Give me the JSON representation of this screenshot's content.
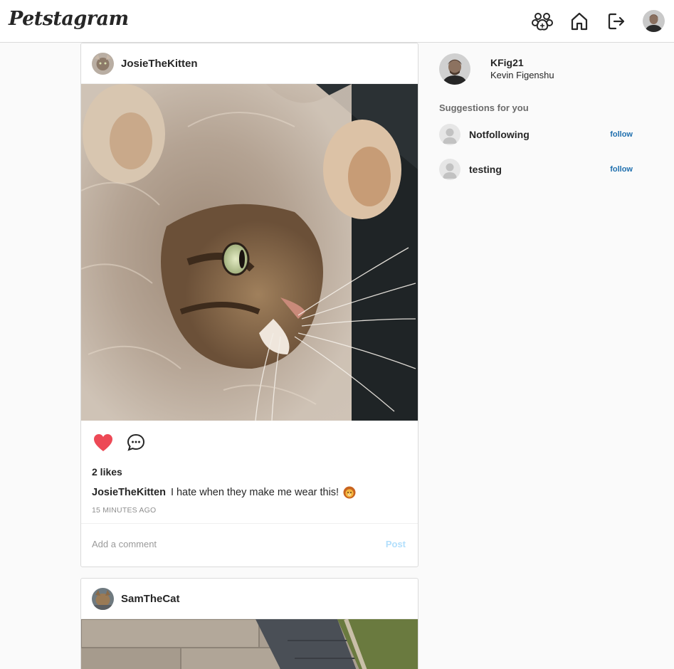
{
  "app": {
    "logo_text": "Petstagram"
  },
  "nav": {
    "icons": [
      "new-post-paw-icon",
      "home-icon",
      "logout-icon"
    ],
    "avatar_alt": "KFig21"
  },
  "feed": {
    "posts": [
      {
        "username": "JosieTheKitten",
        "likes_label": "2 likes",
        "liked": true,
        "caption_user": "JosieTheKitten",
        "caption_text": "I hate when they make me wear this!",
        "caption_emoji": "lion-face-emoji",
        "timestamp": "15 MINUTES AGO",
        "comment_placeholder": "Add a comment",
        "post_label": "Post"
      },
      {
        "username": "SamTheCat"
      }
    ]
  },
  "sidebar": {
    "username": "KFig21",
    "full_name": "Kevin Figenshu",
    "suggestions_title": "Suggestions for you",
    "suggestions": [
      {
        "username": "Notfollowing",
        "action": "follow"
      },
      {
        "username": "testing",
        "action": "follow"
      }
    ]
  },
  "colors": {
    "like_red": "#ed4956",
    "follow_blue": "#1f6fae",
    "post_button_disabled": "#b2dffc",
    "border": "#dbdbdb",
    "background": "#fafafa"
  }
}
